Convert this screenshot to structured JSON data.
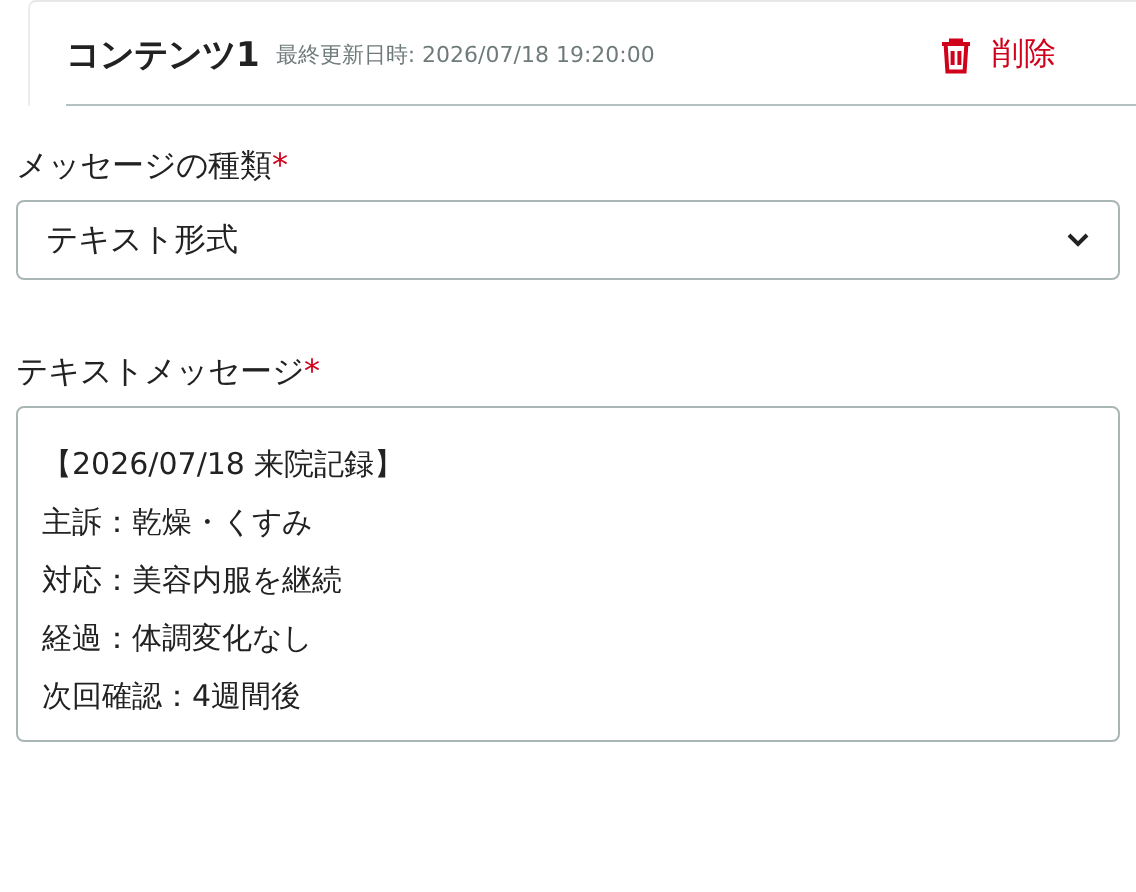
{
  "header": {
    "title": "コンテンツ1",
    "updated": "最終更新日時: 2026/07/18 19:20:00",
    "delete_button": "削除"
  },
  "fields": [
    {
      "kind": "select",
      "label": "メッセージの種類",
      "required_mark": "*",
      "value": "テキスト形式"
    },
    {
      "kind": "textarea",
      "label": "テキストメッセージ",
      "required_mark": "*",
      "lines": [
        "【2026/07/18 来院記録】",
        "主訴：乾燥・くすみ",
        "対応：美容内服を継続",
        "経過：体調変化なし",
        "次回確認：4週間後"
      ]
    }
  ]
}
